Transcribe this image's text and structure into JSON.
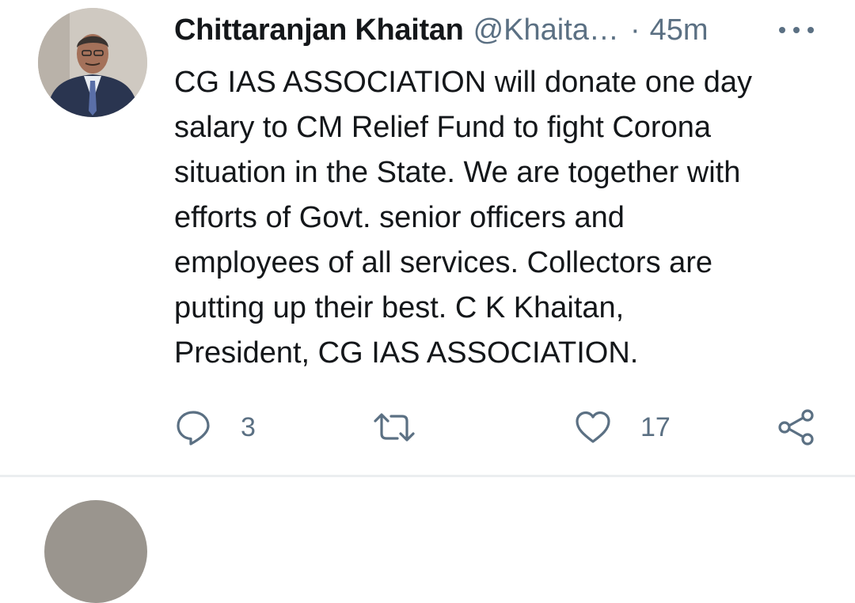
{
  "tweet": {
    "author_name": "Chittaranjan Khaitan",
    "handle": "@Khaita…",
    "separator": "·",
    "time": "45m",
    "text_lines": [
      "CG IAS ASSOCIATION will donate one day",
      "salary to CM Relief Fund to fight Corona",
      "situation in the State. We are together with",
      "efforts of Govt. senior officers and",
      "employees of all services. Collectors are",
      "putting up their best. C K Khaitan,",
      "President, CG IAS ASSOCIATION."
    ],
    "actions": {
      "reply": {
        "icon": "reply-icon",
        "count": "3"
      },
      "retweet": {
        "icon": "retweet-icon",
        "count": ""
      },
      "like": {
        "icon": "heart-icon",
        "count": "17"
      },
      "share": {
        "icon": "share-icon"
      }
    },
    "more_icon": "more-options-icon"
  },
  "colors": {
    "text": "#14171a",
    "secondary": "#5b7083",
    "divider": "#ebeef0",
    "background": "#ffffff"
  }
}
